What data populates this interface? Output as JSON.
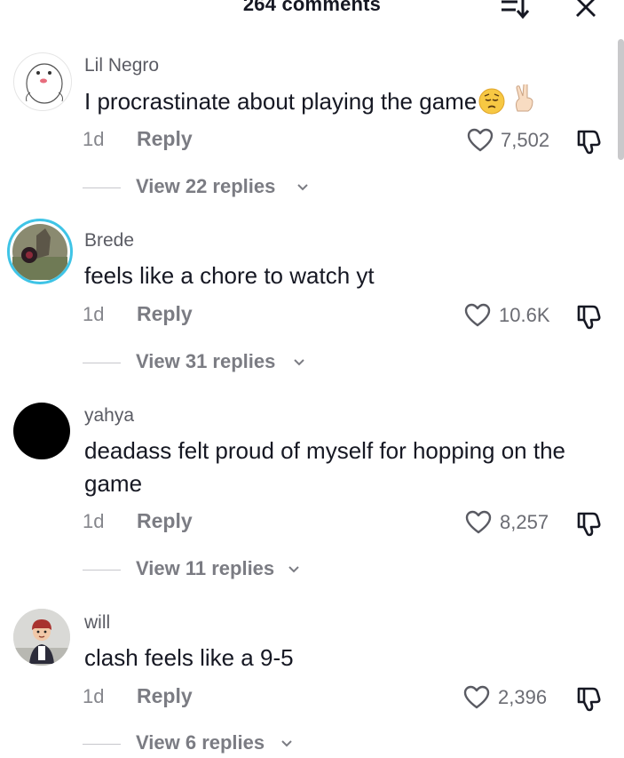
{
  "header": {
    "title": "264 comments"
  },
  "comments": [
    {
      "username": "Lil Negro",
      "text": "I procrastinate about playing the game",
      "emojis": [
        "pensive-face",
        "victory-hand"
      ],
      "time": "1d",
      "reply_label": "Reply",
      "likes": "7,502",
      "view_replies": "View 22 replies"
    },
    {
      "username": "Brede",
      "text": "feels like a chore to watch yt",
      "time": "1d",
      "reply_label": "Reply",
      "likes": "10.6K",
      "view_replies": "View 31 replies"
    },
    {
      "username": "yahya",
      "text": "deadass felt proud of myself for hopping on the game",
      "time": "1d",
      "reply_label": "Reply",
      "likes": "8,257",
      "view_replies": "View 11 replies"
    },
    {
      "username": "will",
      "text": "clash feels like a 9-5",
      "time": "1d",
      "reply_label": "Reply",
      "likes": "2,396",
      "view_replies": "View 6 replies"
    }
  ]
}
